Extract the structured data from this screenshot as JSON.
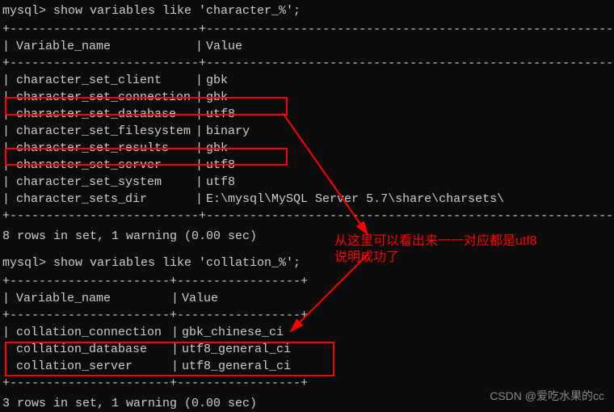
{
  "prompt1": "mysql> show variables like 'character_%';",
  "table1": {
    "header": {
      "col1": "Variable_name",
      "col2": "Value"
    },
    "border_top": "+--------------------------+---------------------------------------------------------+",
    "border_head": "+--------------------------+---------------------------------------------------------+",
    "border_bottom": "+--------------------------+---------------------------------------------------------+",
    "rows": [
      {
        "col1": "character_set_client",
        "col2": "gbk"
      },
      {
        "col1": "character_set_connection",
        "col2": "gbk"
      },
      {
        "col1": "character_set_database",
        "col2": "utf8"
      },
      {
        "col1": "character_set_filesystem",
        "col2": "binary"
      },
      {
        "col1": "character_set_results",
        "col2": "gbk"
      },
      {
        "col1": "character_set_server",
        "col2": "utf8"
      },
      {
        "col1": "character_set_system",
        "col2": "utf8"
      },
      {
        "col1": "character_sets_dir",
        "col2": "E:\\mysql\\MySQL Server 5.7\\share\\charsets\\"
      }
    ]
  },
  "result1": "8 rows in set, 1 warning (0.00 sec)",
  "prompt2": "mysql> show variables like 'collation_%';",
  "table2": {
    "header": {
      "col1": "Variable_name",
      "col2": "Value"
    },
    "border_top": "+----------------------+-----------------+",
    "border_head": "+----------------------+-----------------+",
    "border_bottom": "+----------------------+-----------------+",
    "rows": [
      {
        "col1": "collation_connection",
        "col2": "gbk_chinese_ci"
      },
      {
        "col1": "collation_database",
        "col2": "utf8_general_ci"
      },
      {
        "col1": "collation_server",
        "col2": "utf8_general_ci"
      }
    ]
  },
  "result2": "3 rows in set, 1 warning (0.00 sec)",
  "annotation_line1": "从这里可以看出来一一对应都是utf8",
  "annotation_line2": "说明成功了",
  "watermark": "CSDN @爱吃水果的cc"
}
